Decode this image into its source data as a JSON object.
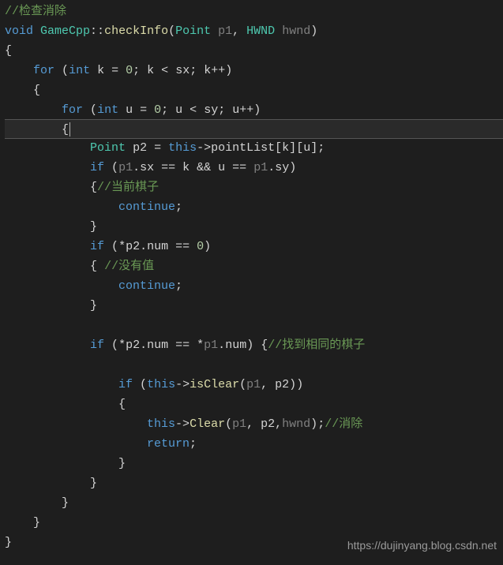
{
  "code": {
    "c1": "//检查消除",
    "sig": {
      "void": "void",
      "cls": "GameCpp",
      "sep": "::",
      "fn": "checkInfo",
      "lp": "(",
      "t1": "Point",
      "p1": "p1",
      "comma": ", ",
      "t2": "HWND",
      "p2": "hwnd",
      "rp": ")"
    },
    "lb": "{",
    "rb": "}",
    "for1": {
      "for": "for",
      "lp": "(",
      "int": "int",
      "v": "k",
      "eq": " = ",
      "z": "0",
      "sc1": "; ",
      "v2": "k",
      "lt": " < ",
      "sx": "sx",
      "sc2": "; ",
      "v3": "k",
      "inc": "++",
      "rp": ")"
    },
    "for2": {
      "for": "for",
      "lp": "(",
      "int": "int",
      "v": "u",
      "eq": " = ",
      "z": "0",
      "sc1": "; ",
      "v2": "u",
      "lt": " < ",
      "sy": "sy",
      "sc2": "; ",
      "v3": "u",
      "inc": "++",
      "rp": ")"
    },
    "decl": {
      "t": "Point",
      "v": "p2",
      "eq": " = ",
      "this": "this",
      "arrow": "->",
      "m": "pointList",
      "lb1": "[",
      "k": "k",
      "rb1": "]",
      "lb2": "[",
      "u": "u",
      "rb2": "]",
      "sc": ";"
    },
    "if1": {
      "if": "if",
      "lp": " (",
      "p1a": "p1",
      "d1": ".",
      "sx": "sx",
      "eq1": " == ",
      "k": "k",
      "and": " && ",
      "u": "u",
      "eq2": " == ",
      "p1b": "p1",
      "d2": ".",
      "sy": "sy",
      "rp": ")"
    },
    "c2": "//当前棋子",
    "cont": "continue",
    "sc": ";",
    "if2": {
      "if": "if",
      "lp": " (",
      "star": "*",
      "p2": "p2",
      "d": ".",
      "num": "num",
      "eq": " == ",
      "z": "0",
      "rp": ")"
    },
    "c3": "//没有值",
    "if3": {
      "if": "if",
      "lp": " (",
      "star1": "*",
      "p2": "p2",
      "d1": ".",
      "num1": "num",
      "eq": " == ",
      "star2": "*",
      "p1": "p1",
      "d2": ".",
      "num2": "num",
      "rp": ") ",
      "lb": "{",
      "c": "//找到相同的棋子"
    },
    "if4": {
      "if": "if",
      "lp": " (",
      "this": "this",
      "arrow": "->",
      "fn": "isClear",
      "flp": "(",
      "p1": "p1",
      "comma": ", ",
      "p2": "p2",
      "frp": ")",
      "rp": ")"
    },
    "call": {
      "this": "this",
      "arrow": "->",
      "fn": "Clear",
      "lp": "(",
      "p1": "p1",
      "c1": ", ",
      "p2": "p2",
      "c2": ",",
      "hwnd": "hwnd",
      "rp": ")",
      "sc": ";",
      "cmt": "//消除"
    },
    "ret": "return"
  },
  "watermark": "https://dujinyang.blog.csdn.net"
}
